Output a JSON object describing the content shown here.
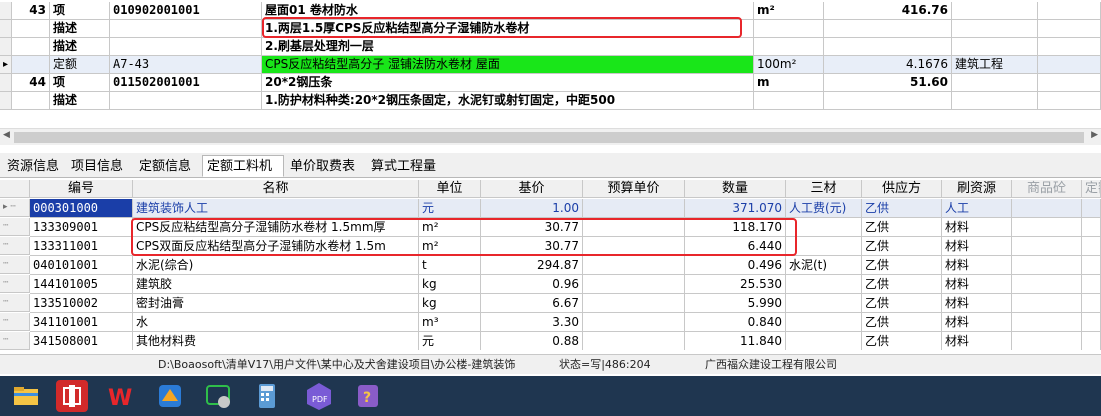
{
  "upper_rows": [
    {
      "num": "43",
      "type": "项",
      "code": "010902001001",
      "desc": "屋面01 卷材防水",
      "unit": "m²",
      "qty": "416.76",
      "extra": ""
    },
    {
      "num": "",
      "type": "描述",
      "code": "",
      "desc": "1.两层1.5厚CPS反应粘结型高分子湿铺防水卷材",
      "unit": "",
      "qty": "",
      "extra": ""
    },
    {
      "num": "",
      "type": "描述",
      "code": "",
      "desc": "2.刷基层处理剂一层",
      "unit": "",
      "qty": "",
      "extra": ""
    },
    {
      "num": "",
      "type": "定额",
      "code": "A7-43",
      "desc": "CPS反应粘结型高分子 湿铺法防水卷材 屋面",
      "unit": "100m²",
      "qty": "4.1676",
      "extra": "建筑工程"
    },
    {
      "num": "44",
      "type": "项",
      "code": "011502001001",
      "desc": "20*2钢压条",
      "unit": "m",
      "qty": "51.60",
      "extra": ""
    },
    {
      "num": "",
      "type": "描述",
      "code": "",
      "desc": "1.防护材料种类:20*2钢压条固定，水泥钉或射钉固定，中距500",
      "unit": "",
      "qty": "",
      "extra": ""
    }
  ],
  "tabs": [
    "资源信息",
    "项目信息",
    "定额信息",
    "定额工料机",
    "单价取费表",
    "算式工程量"
  ],
  "active_tab": "定额工料机",
  "lower_headers": {
    "code": "编号",
    "name": "名称",
    "unit": "单位",
    "base": "基价",
    "budget": "预算单价",
    "qty": "数量",
    "sancai": "三材",
    "supplier": "供应方",
    "refresh": "刷资源",
    "goods": "商品砼",
    "ding": "定额"
  },
  "lower_rows": [
    {
      "code": "000301000",
      "name": "建筑装饰人工",
      "unit": "元",
      "base": "1.00",
      "budget": "",
      "qty": "371.070",
      "sancai": "人工费(元)",
      "supplier": "乙供",
      "cat": "人工"
    },
    {
      "code": "133309001",
      "name": "CPS反应粘结型高分子湿铺防水卷材 1.5mm厚",
      "unit": "m²",
      "base": "30.77",
      "budget": "",
      "qty": "118.170",
      "sancai": "",
      "supplier": "乙供",
      "cat": "材料"
    },
    {
      "code": "133311001",
      "name": "CPS双面反应粘结型高分子湿铺防水卷材 1.5m",
      "unit": "m²",
      "base": "30.77",
      "budget": "",
      "qty": "6.440",
      "sancai": "",
      "supplier": "乙供",
      "cat": "材料"
    },
    {
      "code": "040101001",
      "name": "水泥(综合)",
      "unit": "t",
      "base": "294.87",
      "budget": "",
      "qty": "0.496",
      "sancai": "水泥(t)",
      "supplier": "乙供",
      "cat": "材料"
    },
    {
      "code": "144101005",
      "name": "建筑胶",
      "unit": "kg",
      "base": "0.96",
      "budget": "",
      "qty": "25.530",
      "sancai": "",
      "supplier": "乙供",
      "cat": "材料"
    },
    {
      "code": "133510002",
      "name": "密封油膏",
      "unit": "kg",
      "base": "6.67",
      "budget": "",
      "qty": "5.990",
      "sancai": "",
      "supplier": "乙供",
      "cat": "材料"
    },
    {
      "code": "341101001",
      "name": "水",
      "unit": "m³",
      "base": "3.30",
      "budget": "",
      "qty": "0.840",
      "sancai": "",
      "supplier": "乙供",
      "cat": "材料"
    },
    {
      "code": "341508001",
      "name": "其他材料费",
      "unit": "元",
      "base": "0.88",
      "budget": "",
      "qty": "11.840",
      "sancai": "",
      "supplier": "乙供",
      "cat": "材料"
    }
  ],
  "status": {
    "path": "D:\\Boaosoft\\清单V17\\用户文件\\某中心及犬舍建设项目\\办公楼-建筑装饰",
    "state": "状态=写|486:204",
    "company": "广西福众建设工程有限公司"
  },
  "taskbar_icons": [
    "file-explorer-icon",
    "app-red-icon",
    "wps-icon",
    "app-blue-icon",
    "wechat-icon",
    "calculator-icon",
    "pdf-icon",
    "app-purple-icon"
  ],
  "colors": {
    "highlight_green": "#19e619",
    "red_box": "#e8262b",
    "selected_blue": "#1a3ea8",
    "taskbar": "#1f3650"
  }
}
